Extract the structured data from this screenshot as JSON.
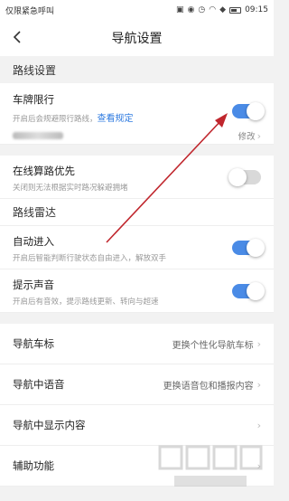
{
  "status_bar": {
    "left_text": "仅限紧急呼叫",
    "time": "09:15"
  },
  "header": {
    "title": "导航设置"
  },
  "sections": {
    "route_settings": {
      "title": "路线设置",
      "plate_limit": {
        "title": "车牌限行",
        "desc": "开启后会规避限行路线，",
        "link": "查看规定",
        "modify": "修改",
        "enabled": true
      }
    },
    "online_calc": {
      "title": "在线算路优先",
      "desc": "关闭则无法根据实时路况躲避拥堵",
      "enabled": false
    },
    "route_radar": {
      "title": "路线雷达",
      "auto_enter": {
        "title": "自动进入",
        "desc": "开启后智能判断行驶状态自由进入，解放双手",
        "enabled": true
      },
      "prompt_sound": {
        "title": "提示声音",
        "desc": "开启后有音效，提示路线更新、转向与超速",
        "enabled": true
      }
    }
  },
  "menu": {
    "nav_icon": {
      "label": "导航车标",
      "value": "更换个性化导航车标"
    },
    "voice": {
      "label": "导航中语音",
      "value": "更换语音包和播报内容"
    },
    "display": {
      "label": "导航中显示内容",
      "value": ""
    },
    "aux": {
      "label": "辅助功能",
      "value": ""
    }
  },
  "colors": {
    "accent": "#4a8be6",
    "link": "#2f7be0",
    "annotation_arrow": "#c0262d"
  }
}
